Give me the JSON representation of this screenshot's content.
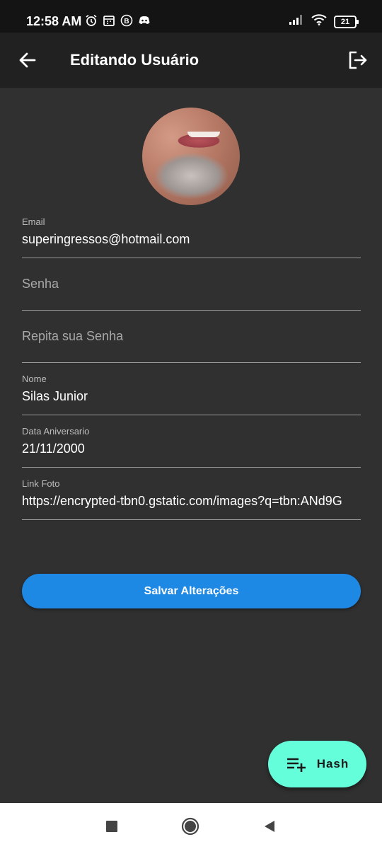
{
  "status_bar": {
    "time": "12:58 AM",
    "battery": "21",
    "icons": [
      "alarm-icon",
      "calendar-icon",
      "b-badge-icon",
      "discord-icon",
      "signal-icon",
      "wifi-icon",
      "battery-icon"
    ]
  },
  "app_bar": {
    "title": "Editando Usuário",
    "back_icon": "arrow-back-icon",
    "logout_icon": "logout-icon"
  },
  "avatar": {
    "icon": "avatar"
  },
  "form": {
    "email": {
      "label": "Email",
      "value": "superingressos@hotmail.com"
    },
    "password": {
      "placeholder": "Senha"
    },
    "repeat_password": {
      "placeholder": "Repita sua Senha"
    },
    "name": {
      "label": "Nome",
      "value": "Silas Junior"
    },
    "birthday": {
      "label": "Data Aniversario",
      "value": "21/11/2000"
    },
    "photo_link": {
      "label": "Link Foto",
      "value": "https://encrypted-tbn0.gstatic.com/images?q=tbn:ANd9G"
    }
  },
  "save_button": {
    "label": "Salvar Alterações"
  },
  "fab": {
    "label": "Hash",
    "icon": "playlist-add-icon"
  },
  "colors": {
    "background": "#303030",
    "app_bar": "#212121",
    "primary": "#1e88e5",
    "fab": "#64ffda"
  }
}
